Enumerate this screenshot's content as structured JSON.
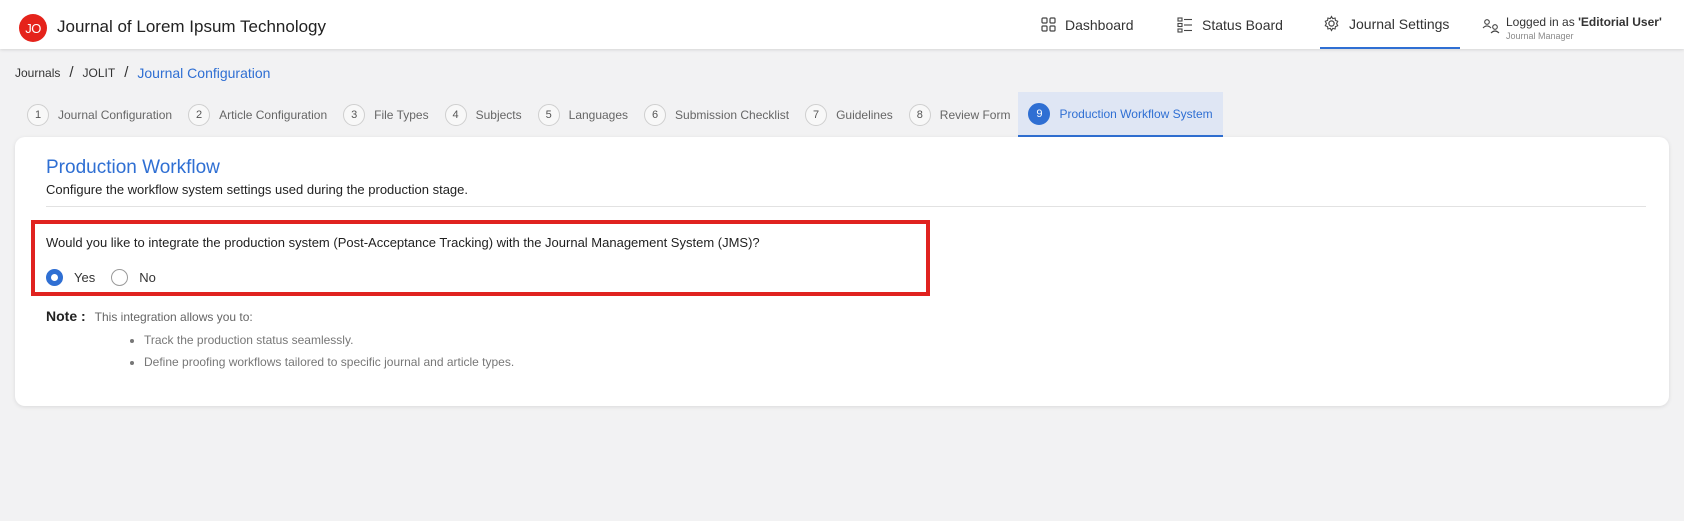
{
  "header": {
    "logo_text": "JO",
    "app_title": "Journal of Lorem Ipsum Technology",
    "nav": [
      {
        "label": "Dashboard",
        "icon": "grid-icon"
      },
      {
        "label": "Status Board",
        "icon": "status-board-icon"
      },
      {
        "label": "Journal Settings",
        "icon": "settings-icon"
      }
    ],
    "user": {
      "prefix": "Logged in as ",
      "name": "'Editorial User'",
      "role": "Journal Manager"
    }
  },
  "breadcrumb": [
    "Journals",
    "JOLIT",
    "Journal Configuration"
  ],
  "steps": [
    {
      "num": "1",
      "label": "Journal Configuration"
    },
    {
      "num": "2",
      "label": "Article Configuration"
    },
    {
      "num": "3",
      "label": "File Types"
    },
    {
      "num": "4",
      "label": "Subjects"
    },
    {
      "num": "5",
      "label": "Languages"
    },
    {
      "num": "6",
      "label": "Submission Checklist"
    },
    {
      "num": "7",
      "label": "Guidelines"
    },
    {
      "num": "8",
      "label": "Review Form"
    },
    {
      "num": "9",
      "label": "Production Workflow System"
    }
  ],
  "card": {
    "title": "Production Workflow",
    "subtitle": "Configure the workflow system settings used during the production stage.",
    "question": "Would you like to integrate the production system (Post-Acceptance Tracking) with the Journal Management System (JMS)?",
    "options": [
      {
        "label": "Yes",
        "selected": true
      },
      {
        "label": "No",
        "selected": false
      }
    ],
    "note_label": "Note :",
    "note_text": "This integration allows you to:",
    "bullets": [
      "Track the production status seamlessly.",
      "Define proofing workflows tailored to specific journal and article types."
    ]
  },
  "colors": {
    "accent": "#2f6fd3",
    "logo": "#e5231b",
    "highlight": "#e0221f"
  }
}
